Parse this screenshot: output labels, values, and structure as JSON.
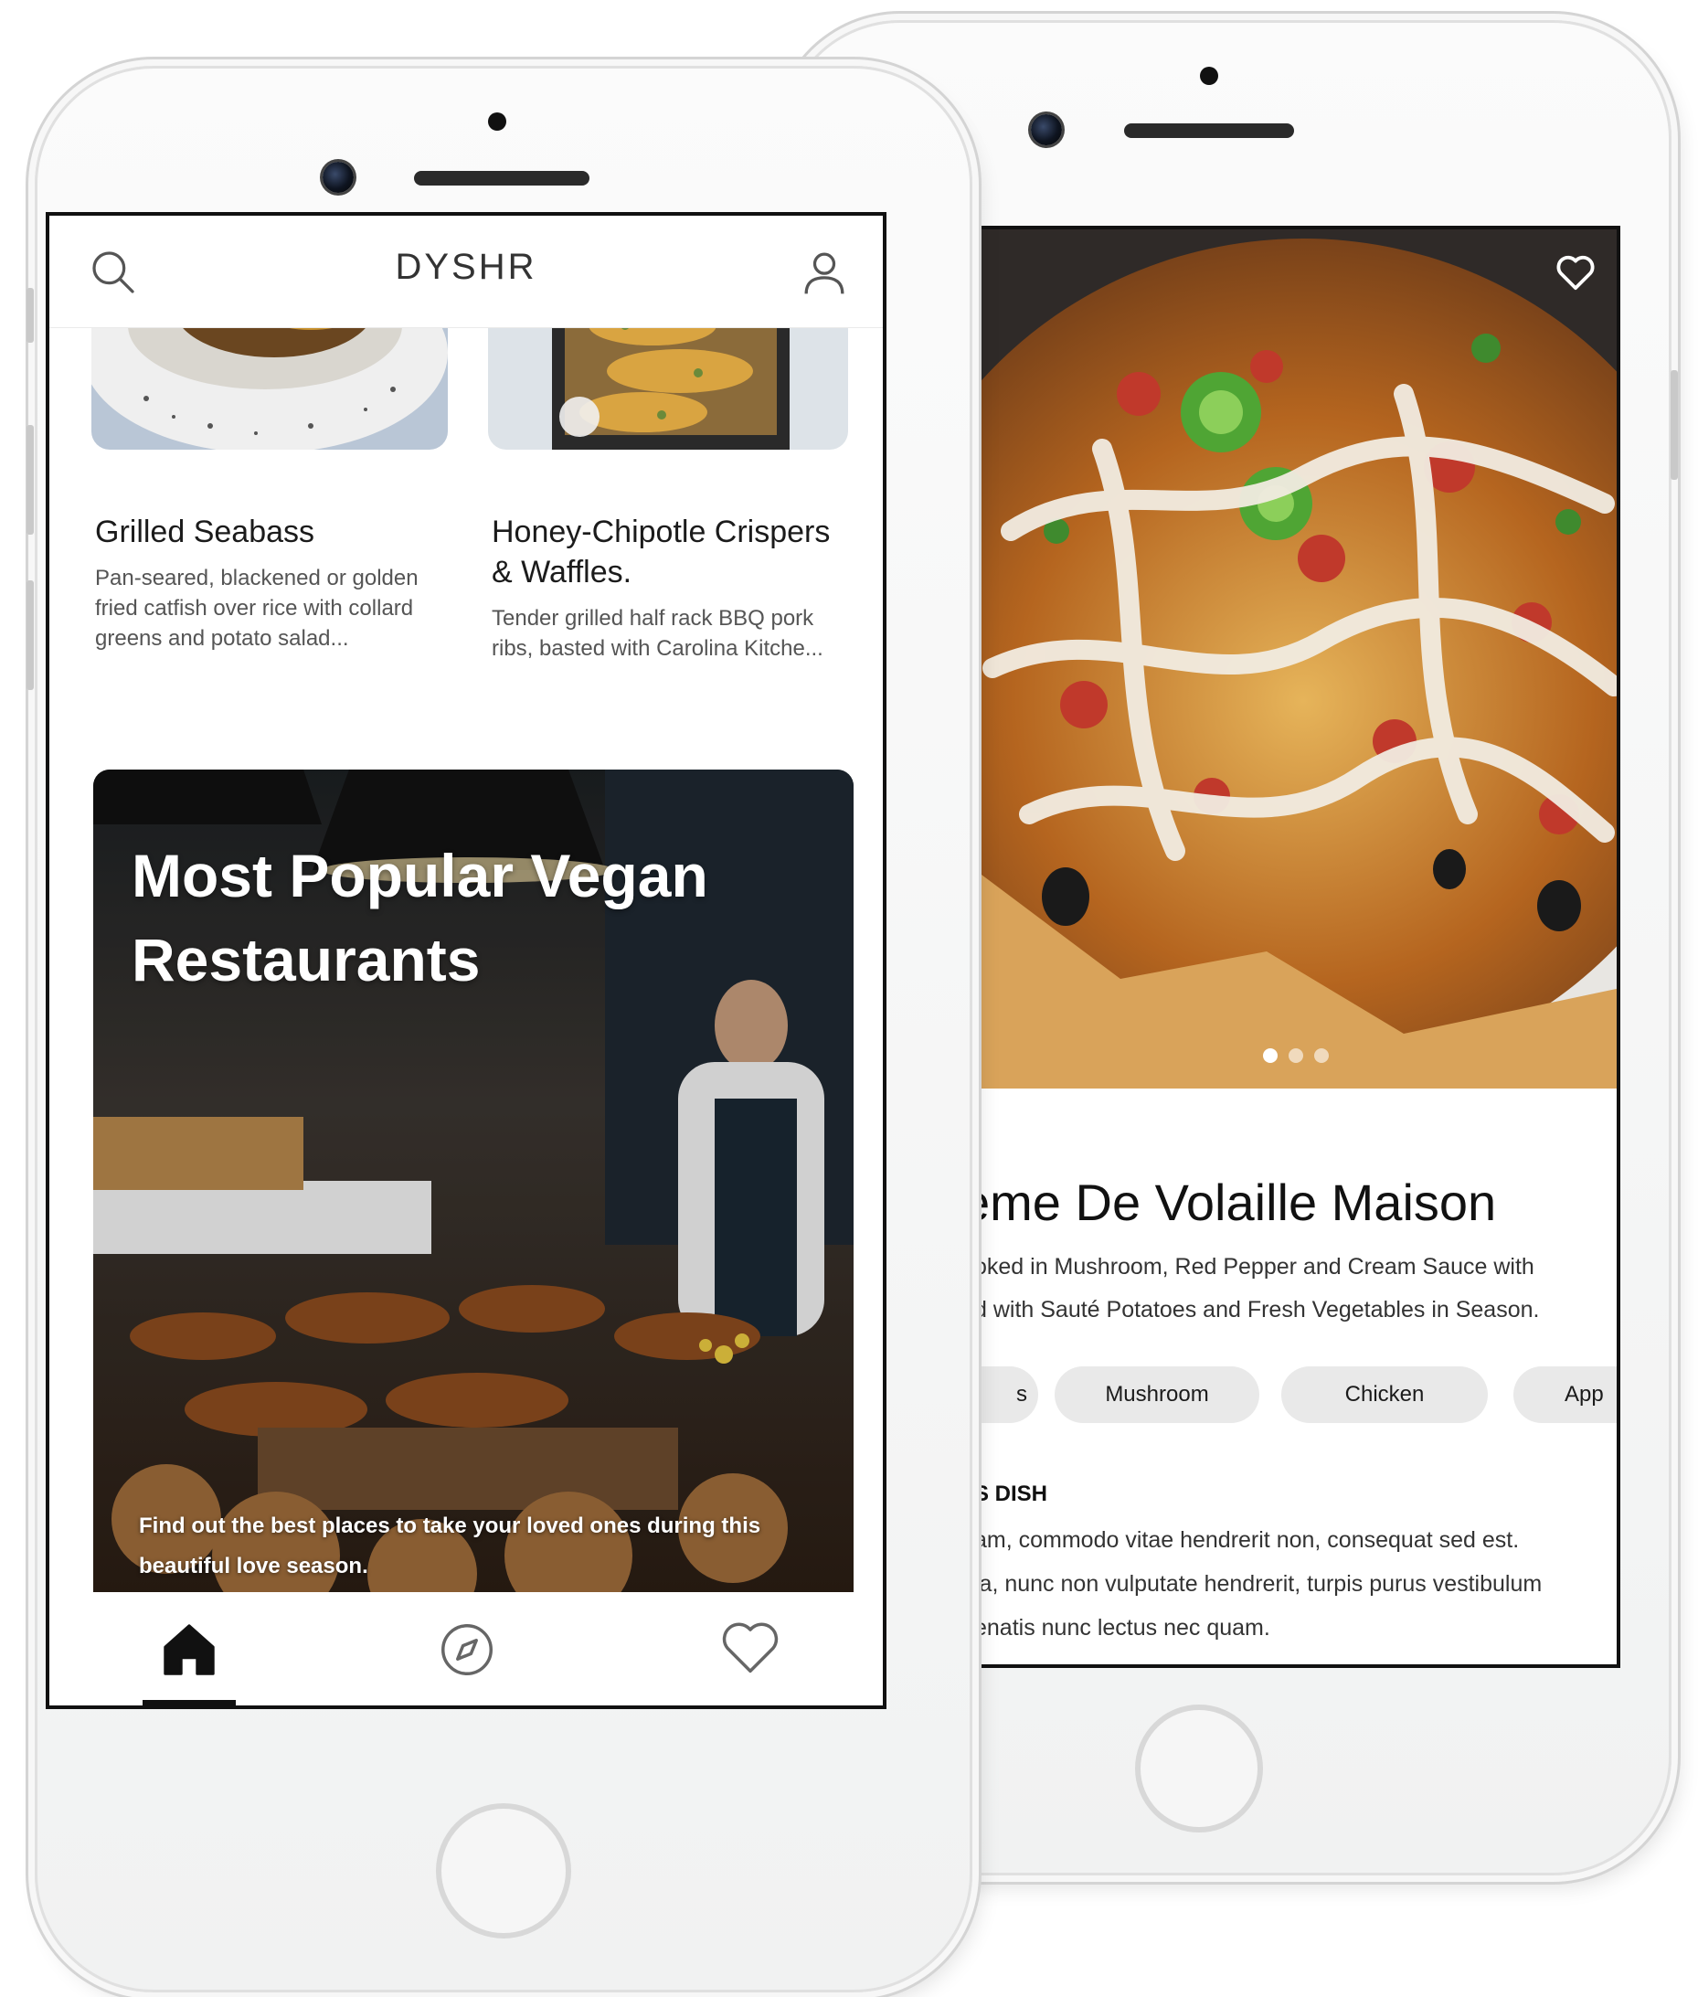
{
  "back_phone": {
    "dish": {
      "title": "eme De Volaille Maison",
      "description_lines": [
        "oked in Mushroom, Red Pepper and Cream Sauce with",
        "d with Sauté Potatoes and Fresh Vegetables in Season."
      ]
    },
    "carousel": {
      "pages": 3,
      "active": 0
    },
    "chips": [
      "s",
      "Mushroom",
      "Chicken",
      "App"
    ],
    "section": {
      "heading": "S DISH",
      "lines": [
        "am, commodo vitae hendrerit non, consequat sed est.",
        "la, nunc non vulputate hendrerit, turpis purus vestibulum",
        "enatis nunc lectus nec quam."
      ]
    },
    "icons": {
      "favorite": "heart-outline-icon"
    }
  },
  "front_phone": {
    "header": {
      "brand": "DYSHR",
      "left_icon": "search-icon",
      "right_icon": "user-icon"
    },
    "cards": [
      {
        "title": "Grilled Seabass",
        "description": "Pan-seared, blackened or golden fried catfish over rice with collard greens and potato salad..."
      },
      {
        "title": "Honey-Chipotle Crispers & Waffles.",
        "description": "Tender grilled half rack BBQ pork ribs, basted with Carolina Kitche..."
      }
    ],
    "banner": {
      "title": "Most Popular Vegan Restaurants",
      "subtitle": "Find out the best places to take your loved ones during this beautiful love season."
    },
    "tabs": [
      {
        "name": "home",
        "icon": "home-icon",
        "active": true
      },
      {
        "name": "explore",
        "icon": "compass-icon",
        "active": false
      },
      {
        "name": "favorites",
        "icon": "heart-icon",
        "active": false
      }
    ]
  },
  "colors": {
    "phone_body": "#f4f5f5",
    "screen_border": "#111111",
    "chip_bg": "#e9e9e9",
    "tab_active": "#111111"
  }
}
